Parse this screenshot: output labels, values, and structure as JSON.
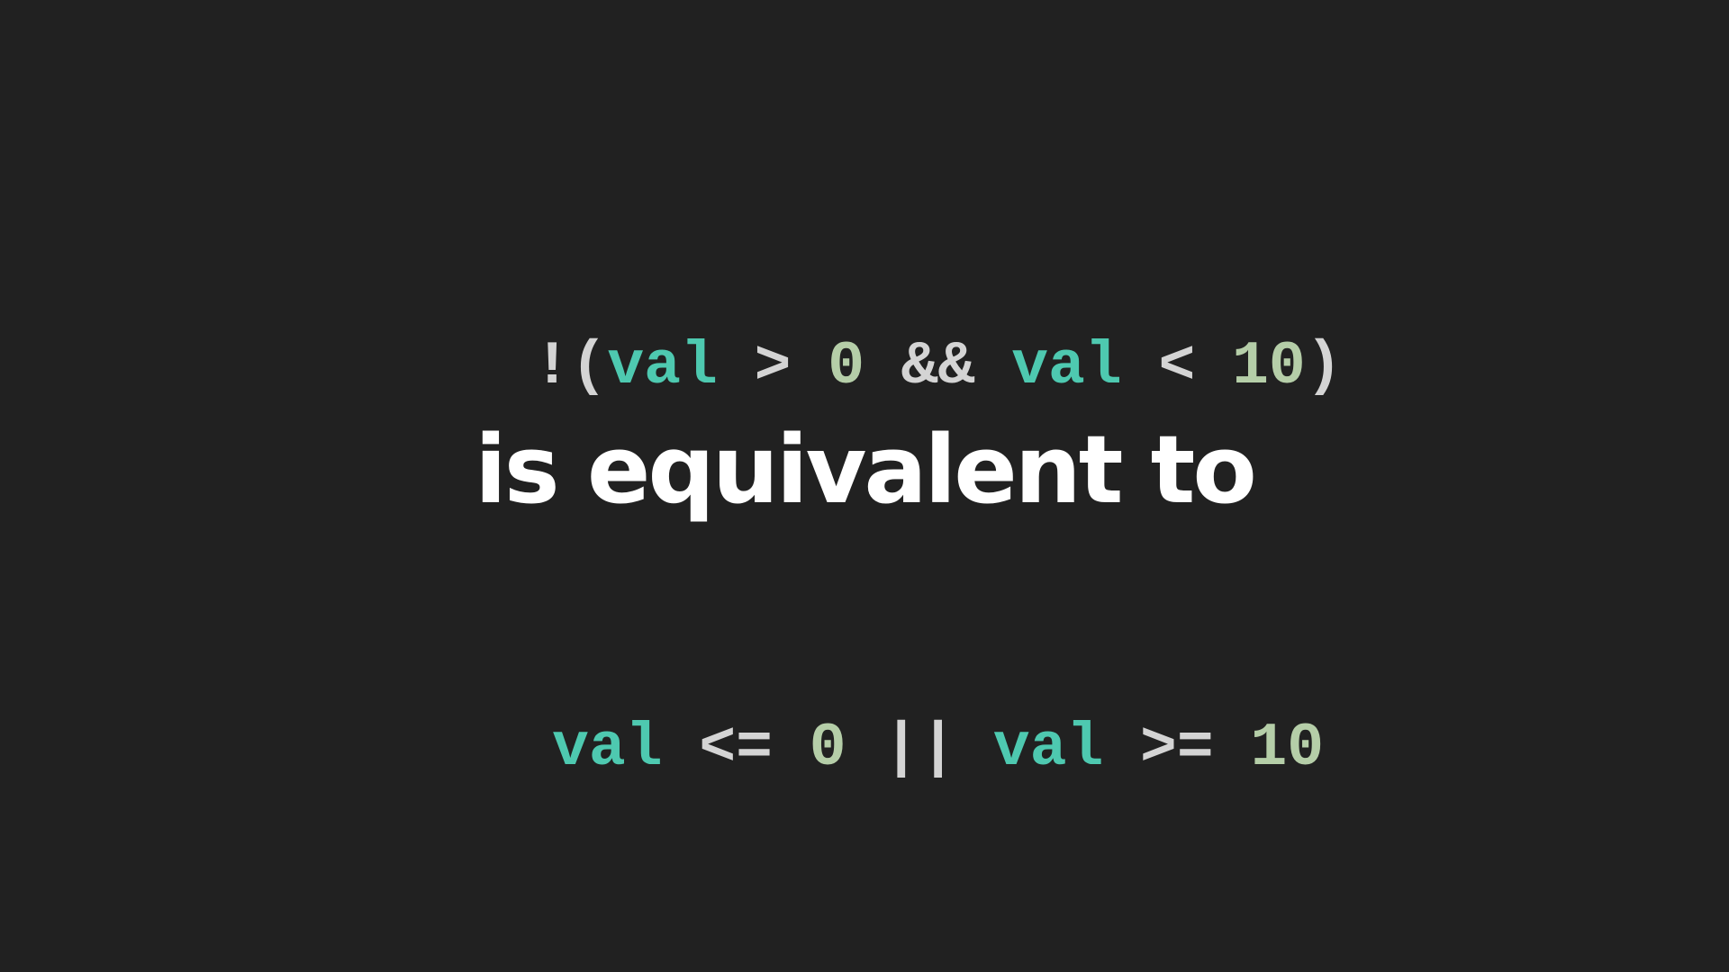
{
  "colors": {
    "background": "#212121",
    "identifier": "#4ec9b0",
    "operator": "#d4d4d4",
    "number": "#b5cea8",
    "caption": "#ffffff"
  },
  "expression_original": {
    "tokens": [
      {
        "text": "!(",
        "kind": "op"
      },
      {
        "text": "val",
        "kind": "ident"
      },
      {
        "text": " > ",
        "kind": "op"
      },
      {
        "text": "0",
        "kind": "num"
      },
      {
        "text": " && ",
        "kind": "op"
      },
      {
        "text": "val",
        "kind": "ident"
      },
      {
        "text": " < ",
        "kind": "op"
      },
      {
        "text": "10",
        "kind": "num"
      },
      {
        "text": ")",
        "kind": "op"
      }
    ]
  },
  "caption": "is equivalent to",
  "expression_equivalent": {
    "tokens": [
      {
        "text": "val",
        "kind": "ident"
      },
      {
        "text": " <= ",
        "kind": "op"
      },
      {
        "text": "0",
        "kind": "num"
      },
      {
        "text": " || ",
        "kind": "op"
      },
      {
        "text": "val",
        "kind": "ident"
      },
      {
        "text": " >= ",
        "kind": "op"
      },
      {
        "text": "10",
        "kind": "num"
      }
    ]
  }
}
